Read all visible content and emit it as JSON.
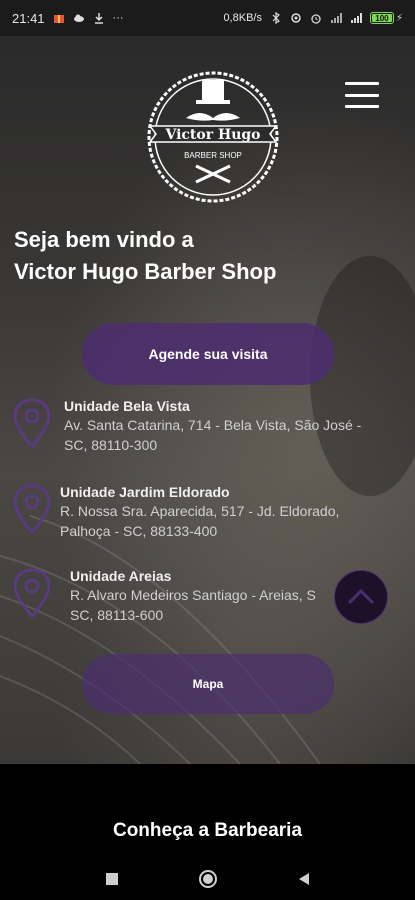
{
  "status_bar": {
    "time": "21:41",
    "speed": "0,8KB/s",
    "battery": "100",
    "menu_dots": "···"
  },
  "header": {
    "logo_text": "Victor Hugo",
    "logo_subtext": "BARBER SHOP",
    "menu_icon": "hamburger-icon"
  },
  "hero": {
    "welcome_line1": "Seja bem vindo a",
    "welcome_line2": "Victor Hugo Barber Shop",
    "visit_button": "Agende sua visita",
    "map_button": "Mapa"
  },
  "units": [
    {
      "name": "Unidade Bela Vista",
      "address_line1": "Av. Santa Catarina, 714 - Bela Vista, São José -",
      "address_line2": "SC, 88110-300"
    },
    {
      "name": "Unidade Jardim Eldorado",
      "address_line1": "R. Nossa Sra. Aparecida, 517 - Jd. Eldorado,",
      "address_line2": "Palhoça - SC, 88133-400"
    },
    {
      "name": "Unidade Areias",
      "address_line1": "R. Alvaro Medeiros Santiago - Areias, S",
      "address_line2": "SC, 88113-600"
    }
  ],
  "section": {
    "title": "Conheça a Barbearia"
  },
  "colors": {
    "accent": "#4c2e6e",
    "pin": "#5a3a80"
  }
}
